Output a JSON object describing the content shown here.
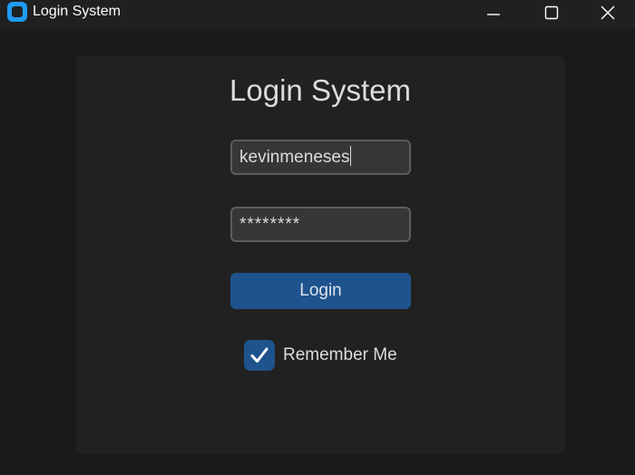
{
  "window": {
    "title": "Login System"
  },
  "form": {
    "heading": "Login System",
    "username_value": "kevinmeneses",
    "password_value": "********",
    "login_label": "Login",
    "remember_label": "Remember Me",
    "remember_checked": true
  },
  "colors": {
    "accent": "#1f538d",
    "app_icon": "#1f9bf0",
    "background": "#1a1a1a",
    "card": "#212121",
    "field_bg": "#343638",
    "field_border": "#5a5d60"
  },
  "icons": {
    "app": "app-logo-icon",
    "minimize": "minimize-icon",
    "maximize": "maximize-icon",
    "close": "close-icon",
    "check": "checkmark-icon"
  }
}
